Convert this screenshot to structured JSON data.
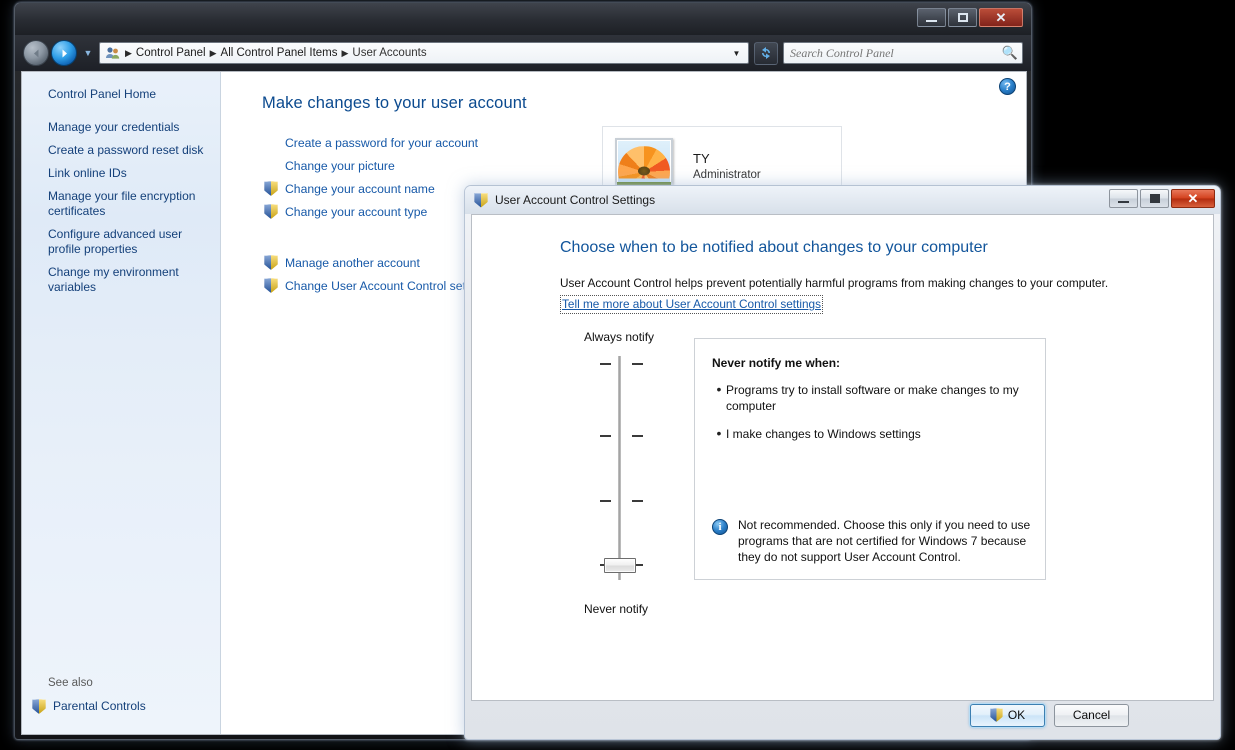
{
  "control_panel_window": {
    "window_buttons": {
      "minimize": "minimize-button",
      "maximize": "maximize-button",
      "close": "close-button"
    },
    "breadcrumb": {
      "segments": [
        "Control Panel",
        "All Control Panel Items",
        "User Accounts"
      ],
      "separator": "▶"
    },
    "search": {
      "placeholder": "Search Control Panel",
      "value": ""
    },
    "sidebar": {
      "home": "Control Panel Home",
      "items": [
        "Manage your credentials",
        "Create a password reset disk",
        "Link online IDs",
        "Manage your file encryption certificates",
        "Configure advanced user profile properties",
        "Change my environment variables"
      ],
      "see_also_label": "See also",
      "see_also_items": [
        "Parental Controls"
      ]
    },
    "main": {
      "heading": "Make changes to your user account",
      "links_group_1": [
        {
          "label": "Create a password for your account",
          "shield": false
        },
        {
          "label": "Change your picture",
          "shield": false
        },
        {
          "label": "Change your account name",
          "shield": true
        },
        {
          "label": "Change your account type",
          "shield": true
        }
      ],
      "links_group_2": [
        {
          "label": "Manage another account",
          "shield": true
        },
        {
          "label": "Change User Account Control settings",
          "shield": true
        }
      ],
      "user_tile": {
        "name": "TY",
        "role": "Administrator"
      },
      "help_label": "?"
    }
  },
  "uac_dialog": {
    "title": "User Account Control Settings",
    "window_buttons": {
      "minimize": "minimize-button",
      "maximize": "maximize-button",
      "close": "close-button"
    },
    "heading": "Choose when to be notified about changes to your computer",
    "description": "User Account Control helps prevent potentially harmful programs from making changes to your computer.",
    "link": "Tell me more about User Account Control settings",
    "slider": {
      "top_label": "Always notify",
      "bottom_label": "Never notify",
      "levels": 4,
      "current_level": 4,
      "current_level_name": "Never notify"
    },
    "info_panel": {
      "title": "Never notify me when:",
      "bullets": [
        "Programs try to install software or make changes to my computer",
        "I make changes to Windows settings"
      ],
      "note": "Not recommended. Choose this only if you need to use programs that are not certified for Windows 7 because they do not support User Account Control.",
      "note_icon": "info-icon"
    },
    "buttons": {
      "ok": "OK",
      "cancel": "Cancel"
    }
  },
  "colors": {
    "accent_link": "#1759a8",
    "heading_blue": "#12559b",
    "sidebar_link": "#14407a",
    "close_button_red": "#d3421f",
    "shield_blue": "#2a62b7",
    "shield_gold": "#f3c518"
  }
}
